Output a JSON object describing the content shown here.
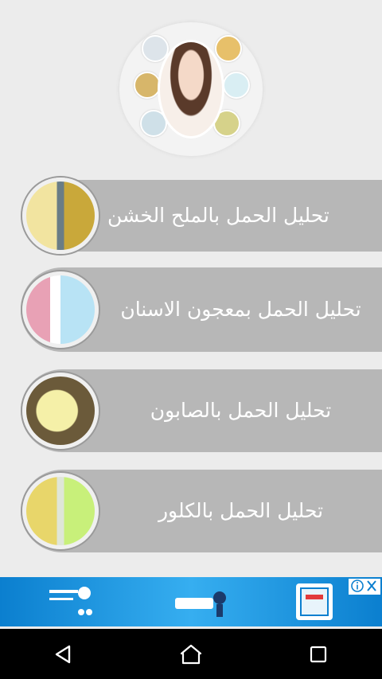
{
  "items": [
    {
      "label": "تحليل الحمل بالملح الخشن",
      "thumb_colors": [
        "#f2e4a0",
        "#c9a83a"
      ]
    },
    {
      "label": "تحليل الحمل بمعجون الاسنان",
      "thumb_colors": [
        "#b8e3f5",
        "#e8a1b5"
      ]
    },
    {
      "label": "تحليل الحمل بالصابون",
      "thumb_colors": [
        "#f5f0a8",
        "#6b5a3a"
      ]
    },
    {
      "label": "تحليل الحمل بالكلور",
      "thumb_colors": [
        "#c8f07a",
        "#e8d66a"
      ]
    }
  ],
  "ad": {
    "close_icon": "close-icon",
    "info_icon": "info-icon"
  },
  "colors": {
    "background": "#ececec",
    "pill": "#b7b7b7",
    "label": "#ffffff",
    "ad_blue": "#0b7fcf"
  },
  "navbar": {
    "back_icon": "back-icon",
    "home_icon": "home-icon",
    "recents_icon": "recents-icon"
  }
}
